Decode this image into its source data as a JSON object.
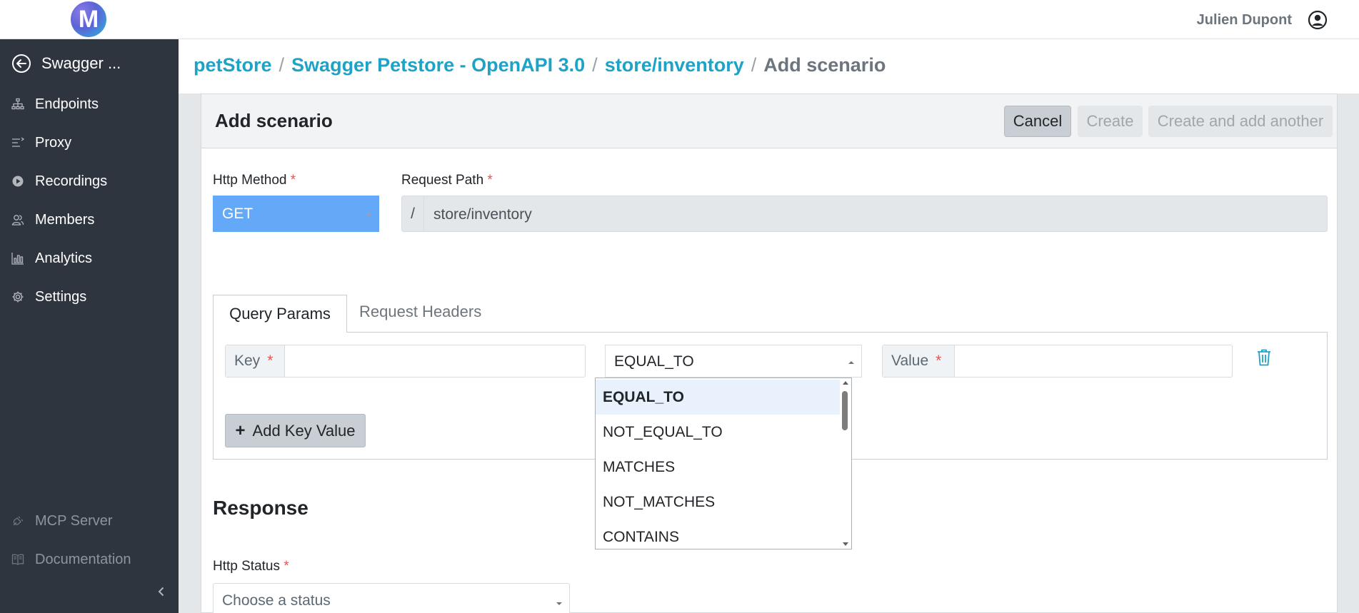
{
  "header": {
    "logo_letter": "M",
    "user_name": "Julien Dupont"
  },
  "sidebar": {
    "back_label": "Swagger ...",
    "items": [
      {
        "label": "Endpoints",
        "icon": "sitemap-icon"
      },
      {
        "label": "Proxy",
        "icon": "proxy-icon"
      },
      {
        "label": "Recordings",
        "icon": "play-circle-icon"
      },
      {
        "label": "Members",
        "icon": "users-icon"
      },
      {
        "label": "Analytics",
        "icon": "chart-icon"
      },
      {
        "label": "Settings",
        "icon": "gear-icon"
      }
    ],
    "footer_items": [
      {
        "label": "MCP Server",
        "icon": "plug-icon"
      },
      {
        "label": "Documentation",
        "icon": "book-icon"
      }
    ]
  },
  "breadcrumb": {
    "items": [
      "petStore",
      "Swagger Petstore - OpenAPI 3.0",
      "store/inventory"
    ],
    "separator": "/",
    "current": "Add scenario"
  },
  "card": {
    "title": "Add scenario",
    "cancel_label": "Cancel",
    "create_label": "Create",
    "create_another_label": "Create and add another"
  },
  "form": {
    "http_method_label": "Http Method",
    "http_method_value": "GET",
    "request_path_label": "Request Path",
    "path_prefix": "/",
    "request_path_value": "store/inventory",
    "required_mark": "*"
  },
  "tabs": {
    "active": "Query Params",
    "inactive": "Request Headers"
  },
  "query_param": {
    "key_label": "Key",
    "operator_value": "EQUAL_TO",
    "value_label": "Value",
    "add_label": "Add Key Value",
    "add_icon": "+"
  },
  "dropdown": {
    "options": [
      "EQUAL_TO",
      "NOT_EQUAL_TO",
      "MATCHES",
      "NOT_MATCHES",
      "CONTAINS"
    ],
    "highlighted": "EQUAL_TO"
  },
  "response": {
    "title": "Response",
    "http_status_label": "Http Status",
    "http_status_placeholder": "Choose a status"
  },
  "colors": {
    "sidebar_bg": "#2f353f",
    "accent_link": "#1ea3c7",
    "method_select_bg": "#63a9f7",
    "required": "#e55353"
  }
}
